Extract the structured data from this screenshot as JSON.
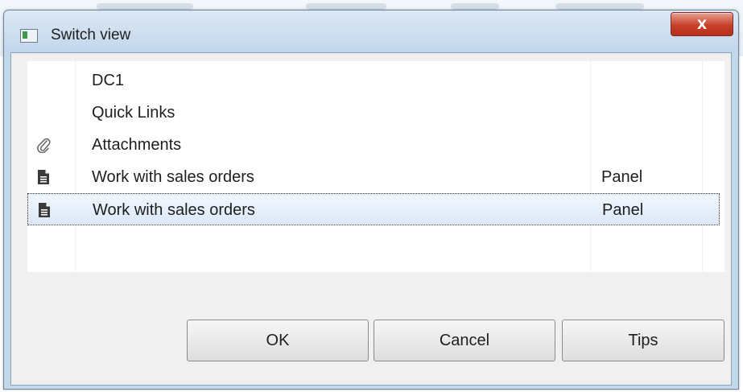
{
  "window": {
    "title": "Switch view",
    "close_label": "X"
  },
  "list": {
    "items": [
      {
        "icon": "none",
        "name": "DC1",
        "type": ""
      },
      {
        "icon": "none",
        "name": "Quick Links",
        "type": ""
      },
      {
        "icon": "paperclip-icon",
        "name": "Attachments",
        "type": ""
      },
      {
        "icon": "document-icon",
        "name": "Work with sales orders",
        "type": "Panel"
      },
      {
        "icon": "document-icon",
        "name": "Work with sales orders",
        "type": "Panel",
        "selected": true
      }
    ]
  },
  "buttons": {
    "ok": "OK",
    "cancel": "Cancel",
    "tips": "Tips"
  }
}
